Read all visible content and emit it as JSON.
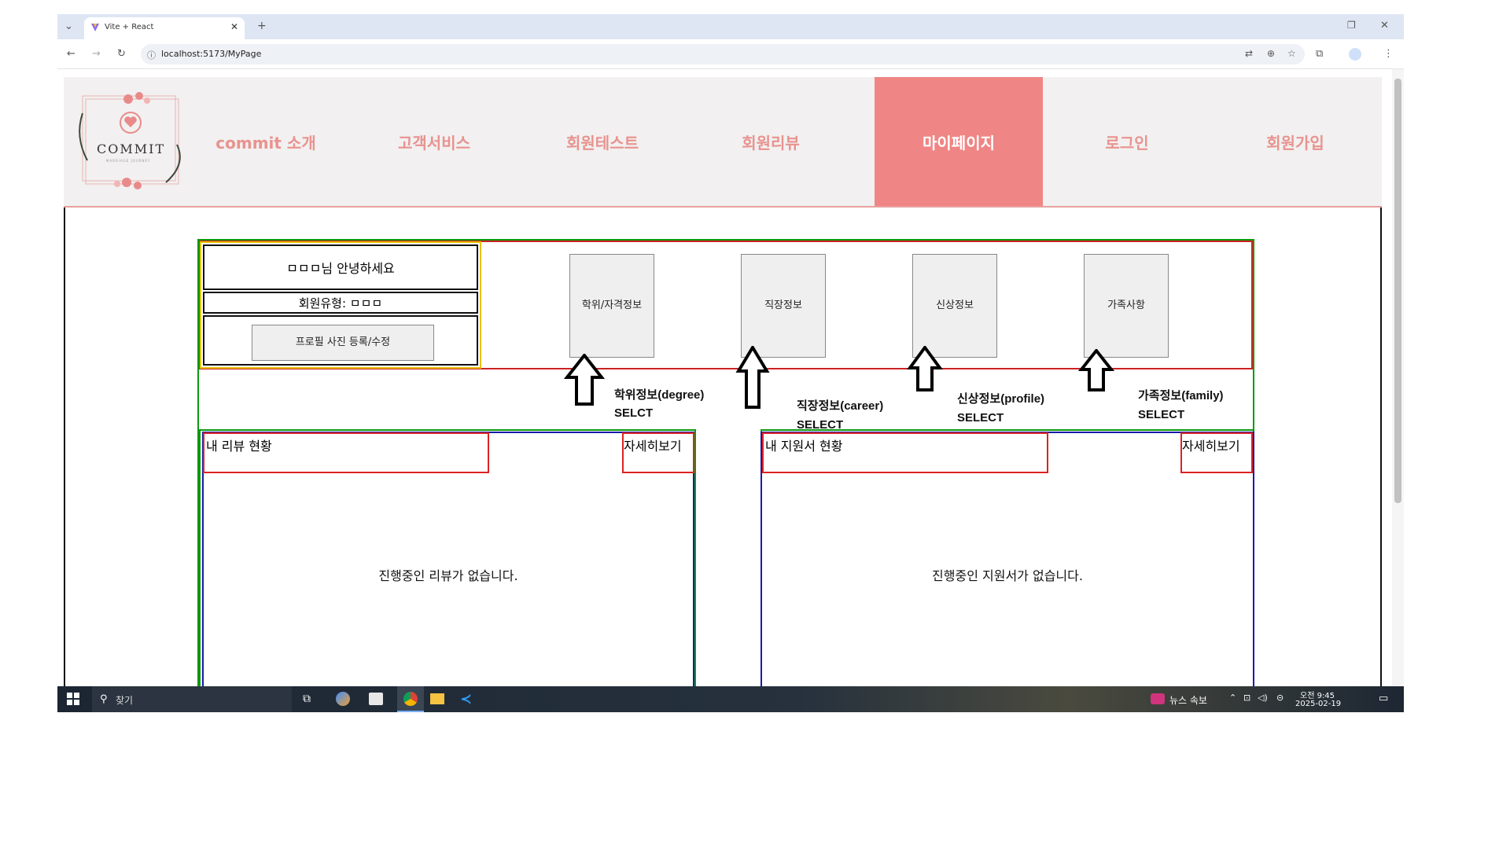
{
  "browser": {
    "tab_title": "Vite + React",
    "url": "localhost:5173/MyPage"
  },
  "logo": {
    "text": "COMMIT",
    "subtext": "MARRIAGE JOURNEY"
  },
  "nav": {
    "items": [
      {
        "label": "commit 소개"
      },
      {
        "label": "고객서비스"
      },
      {
        "label": "회원테스트"
      },
      {
        "label": "회원리뷰"
      },
      {
        "label": "마이페이지",
        "active": true
      },
      {
        "label": "로그인"
      },
      {
        "label": "회원가입"
      }
    ],
    "active_color": "#f08585",
    "text_color": "#e8938f"
  },
  "profile": {
    "greeting": "ㅁㅁㅁ님 안녕하세요",
    "member_type": "회원유형: ㅁㅁㅁ",
    "photo_button": "프로필 사진 등록/수정"
  },
  "info_buttons": [
    {
      "label": "학위/자격정보"
    },
    {
      "label": "직장정보"
    },
    {
      "label": "신상정보"
    },
    {
      "label": "가족사항"
    }
  ],
  "annotations": [
    {
      "title": "학위정보(degree)",
      "sub": "SELCT"
    },
    {
      "title": "직장정보(career)",
      "sub": "SELECT"
    },
    {
      "title": "신상정보(profile)",
      "sub": "SELECT"
    },
    {
      "title": "가족정보(family)",
      "sub": "SELECT"
    }
  ],
  "reviews": {
    "title": "내 리뷰 현황",
    "more": "자세히보기",
    "empty": "진행중인 리뷰가 없습니다."
  },
  "applications": {
    "title": "내 지원서 현황",
    "more": "자세히보기",
    "empty": "진행중인 지원서가 없습니다."
  },
  "taskbar": {
    "search_placeholder": "찾기",
    "news": "뉴스 속보",
    "time": "오전 9:45",
    "date": "2025-02-19"
  }
}
